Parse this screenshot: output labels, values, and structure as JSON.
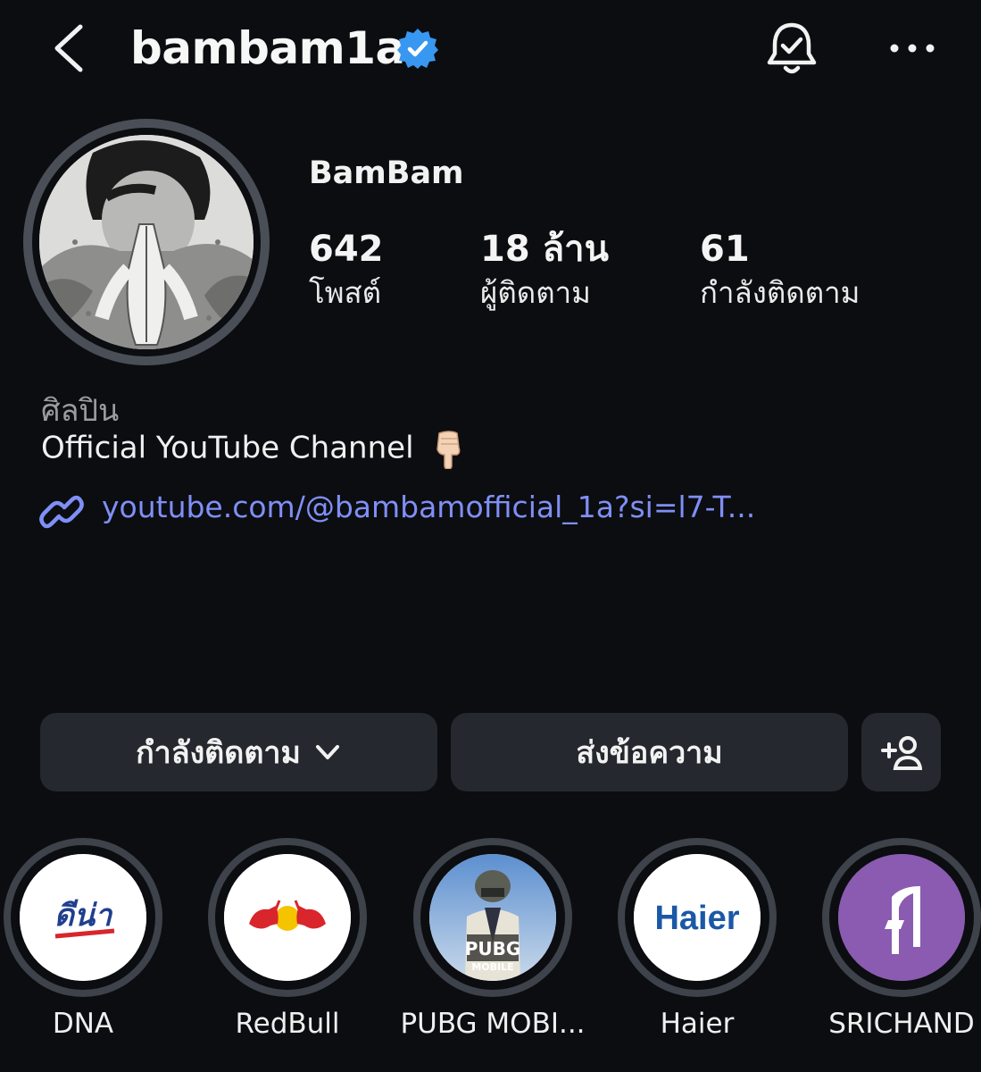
{
  "header": {
    "username": "bambam1a",
    "verified": true,
    "icons": {
      "back": "back-arrow-icon",
      "verified": "verified-badge-icon",
      "notifications": "bell-check-icon",
      "more": "more-dots-icon"
    }
  },
  "profile": {
    "display_name": "BamBam",
    "stats": [
      {
        "value": "642",
        "label": "โพสต์"
      },
      {
        "value": "18 ล้าน",
        "label": "ผู้ติดตาม"
      },
      {
        "value": "61",
        "label": "กำลังติดตาม"
      }
    ],
    "category": "ศิลปิน",
    "bio": "Official YouTube Channel",
    "bio_emoji": "pointing-down-hand",
    "link": "youtube.com/@bambamofficial_1a?si=l7-T..."
  },
  "actions": {
    "following_label": "กำลังติดตาม",
    "message_label": "ส่งข้อความ",
    "add_user_icon": "add-person-icon"
  },
  "highlights": [
    {
      "label": "DNA",
      "logo_text": "ดีน่า"
    },
    {
      "label": "RedBull"
    },
    {
      "label": "PUBG MOBI...",
      "logo_text": "PUBG",
      "logo_subtext": "MOBILE"
    },
    {
      "label": "Haier",
      "logo_text": "Haier"
    },
    {
      "label": "SRICHAND"
    }
  ],
  "colors": {
    "background": "#0c0d10",
    "button": "#25282e",
    "link": "#7f8ff7",
    "verified": "#3897f0",
    "muted_text": "#9a9ca2"
  }
}
